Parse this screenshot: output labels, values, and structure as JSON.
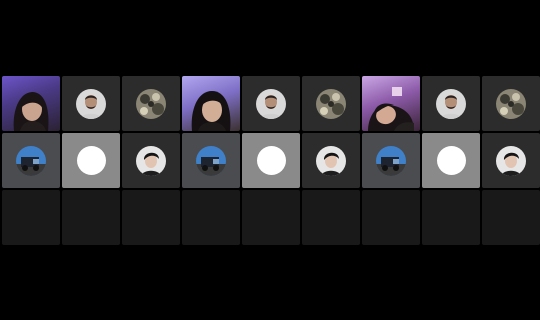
{
  "colors": {
    "background": "#000000",
    "tile_empty": "#191919",
    "tile_dark": "#2c2c2c",
    "tile_mid": "#4b4c4f",
    "tile_light": "#8a8a8a",
    "avatar_white": "#ffffff"
  },
  "panels": [
    {
      "tiles": [
        {
          "kind": "video",
          "icon": "participant-video-icon"
        },
        {
          "kind": "avatar",
          "icon": "man-avatar-icon"
        },
        {
          "kind": "avatar",
          "icon": "camo-avatar-icon"
        },
        {
          "kind": "avatar",
          "icon": "truck-avatar-icon"
        },
        {
          "kind": "avatar",
          "icon": "blank-white-avatar-icon",
          "active": true
        },
        {
          "kind": "avatar",
          "icon": "dark-hair-avatar-icon"
        },
        {
          "kind": "empty"
        },
        {
          "kind": "empty"
        },
        {
          "kind": "empty"
        }
      ]
    },
    {
      "tiles": [
        {
          "kind": "video",
          "icon": "participant-video-icon"
        },
        {
          "kind": "avatar",
          "icon": "man-avatar-icon"
        },
        {
          "kind": "avatar",
          "icon": "camo-avatar-icon"
        },
        {
          "kind": "avatar",
          "icon": "truck-avatar-icon"
        },
        {
          "kind": "avatar",
          "icon": "blank-white-avatar-icon",
          "active": true
        },
        {
          "kind": "avatar",
          "icon": "dark-hair-avatar-icon"
        },
        {
          "kind": "empty"
        },
        {
          "kind": "empty"
        },
        {
          "kind": "empty"
        }
      ]
    },
    {
      "tiles": [
        {
          "kind": "video",
          "icon": "participant-video-icon"
        },
        {
          "kind": "avatar",
          "icon": "man-avatar-icon"
        },
        {
          "kind": "avatar",
          "icon": "camo-avatar-icon"
        },
        {
          "kind": "avatar",
          "icon": "truck-avatar-icon"
        },
        {
          "kind": "avatar",
          "icon": "blank-white-avatar-icon",
          "active": true
        },
        {
          "kind": "avatar",
          "icon": "dark-hair-avatar-icon"
        },
        {
          "kind": "empty"
        },
        {
          "kind": "empty"
        },
        {
          "kind": "empty"
        }
      ]
    }
  ]
}
